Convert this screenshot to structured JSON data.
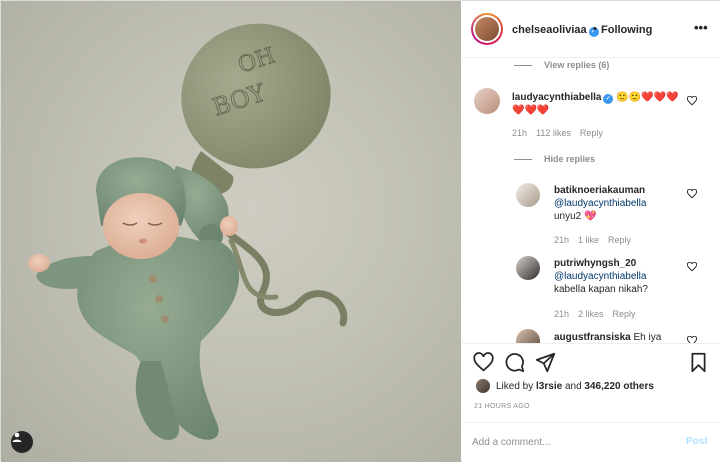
{
  "post": {
    "owner": "chelseaoliviaa",
    "separator": "•",
    "follow_state": "Following",
    "more_glyph": "•••"
  },
  "comments": {
    "view_replies": "View replies (6)",
    "hide_replies": "Hide replies",
    "main": {
      "user": "laudyacynthiabella",
      "text_line1": "🙂🙂❤️❤️❤️",
      "text_line2": "❤️❤️❤️",
      "time": "21h",
      "likes": "112 likes",
      "reply": "Reply"
    },
    "replies": [
      {
        "user": "batiknoeriakauman",
        "mention": "@laudyacynthiabella",
        "text": "unyu2 💖",
        "time": "21h",
        "likes": "1 like",
        "reply": "Reply"
      },
      {
        "user": "putriwhyngsh_20",
        "mention": "@laudyacynthiabella",
        "text": "kabella kapan nikah?",
        "time": "21h",
        "likes": "2 likes",
        "reply": "Reply"
      },
      {
        "user": "augustfransiska",
        "text": "Eh iya"
      }
    ]
  },
  "photo": {
    "balloon_text": "OH BOY"
  },
  "actions": {
    "liked_prefix": "Liked by",
    "liked_user": "l3rsie",
    "liked_and": "and",
    "liked_count": "346,220 others",
    "time_ago": "21 HOURS AGO"
  },
  "composer": {
    "placeholder": "Add a comment...",
    "post_label": "Post"
  },
  "icons": {
    "photo_tag": "user-tag-icon",
    "like": "heart-icon",
    "comment": "comment-icon",
    "share": "paper-plane-icon",
    "save": "bookmark-icon",
    "verified": "verified-badge-icon"
  },
  "colors": {
    "link": "#00376b",
    "verified": "#3897f0",
    "muted": "#8e8e8e",
    "post_disabled": "#b2dffc"
  }
}
